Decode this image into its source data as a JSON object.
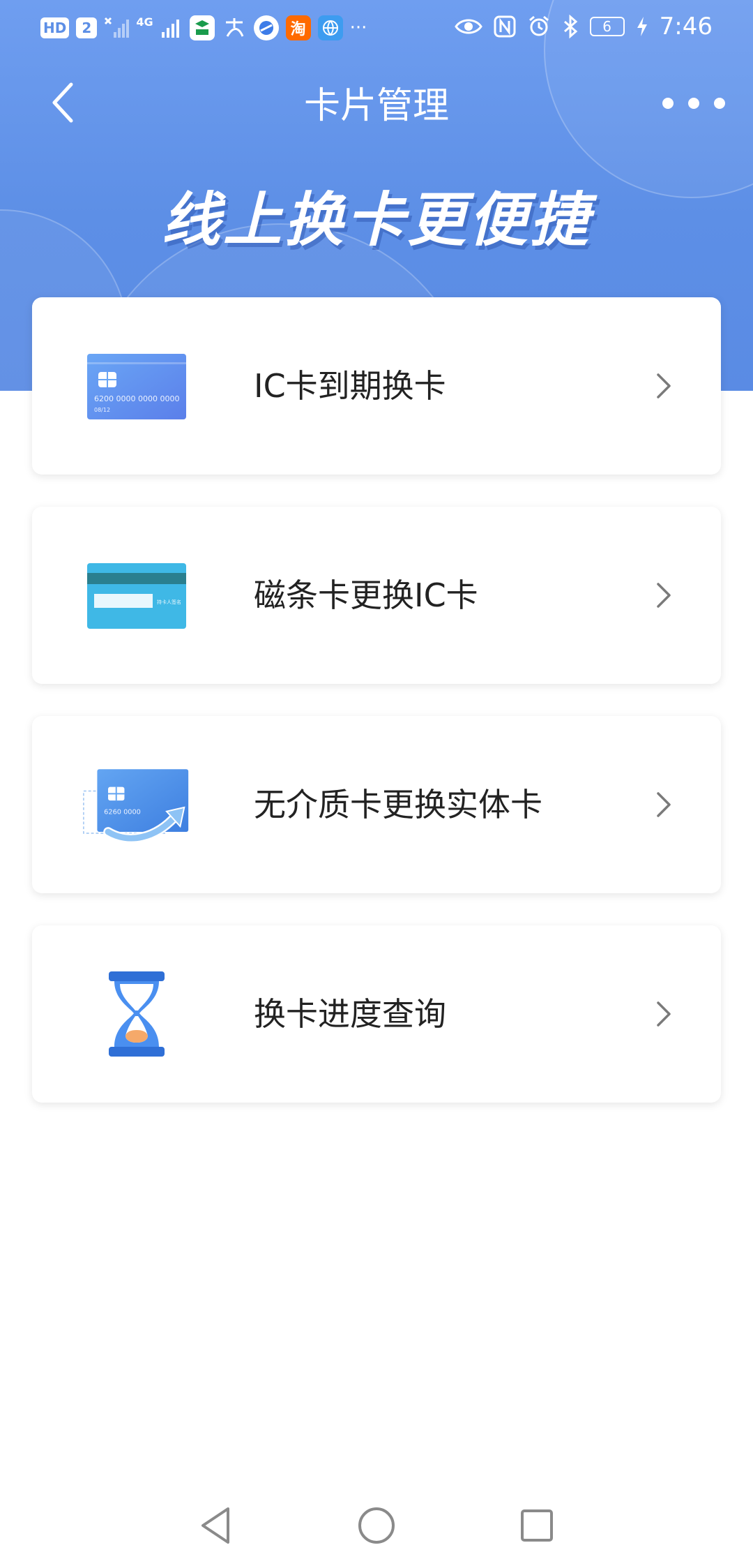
{
  "status_bar": {
    "hd_label": "HD",
    "sim_label": "2",
    "network_label": "4G",
    "battery_level": "6",
    "time": "7:46",
    "more_label": "···",
    "left_icons": [
      "post-app-icon",
      "alipay-icon",
      "browser-icon",
      "taobao-icon",
      "globe-icon"
    ],
    "right_icons": [
      "eye-icon",
      "nfc-icon",
      "alarm-icon",
      "bluetooth-icon",
      "battery-icon",
      "charging-icon"
    ]
  },
  "header": {
    "title": "卡片管理",
    "back_icon": "back-arrow-icon",
    "more_icon": "more-dots-icon"
  },
  "hero": {
    "slogan": "线上换卡更便捷"
  },
  "cards": [
    {
      "label": "IC卡到期换卡",
      "icon": "ic-card-icon",
      "card_number": "6200 0000 0000 0000",
      "card_expiry": "08/12"
    },
    {
      "label": "磁条卡更换IC卡",
      "icon": "magnetic-card-icon",
      "signature_text": "持卡人签名"
    },
    {
      "label": "无介质卡更换实体卡",
      "icon": "virtual-card-icon",
      "card_number": "6260 0000"
    },
    {
      "label": "换卡进度查询",
      "icon": "hourglass-icon"
    }
  ],
  "system_nav": {
    "back_icon": "nav-back-triangle-icon",
    "home_icon": "nav-home-circle-icon",
    "recent_icon": "nav-recent-square-icon"
  },
  "colors": {
    "hero_top": "#6f9ef0",
    "hero_bottom": "#5a8be4",
    "card_blue": "#5b8ff0",
    "magnetic_teal": "#3fb8e6",
    "hourglass_blue": "#2f6fd6",
    "hourglass_sand": "#f5a96a",
    "chevron": "#7a7a7a"
  }
}
